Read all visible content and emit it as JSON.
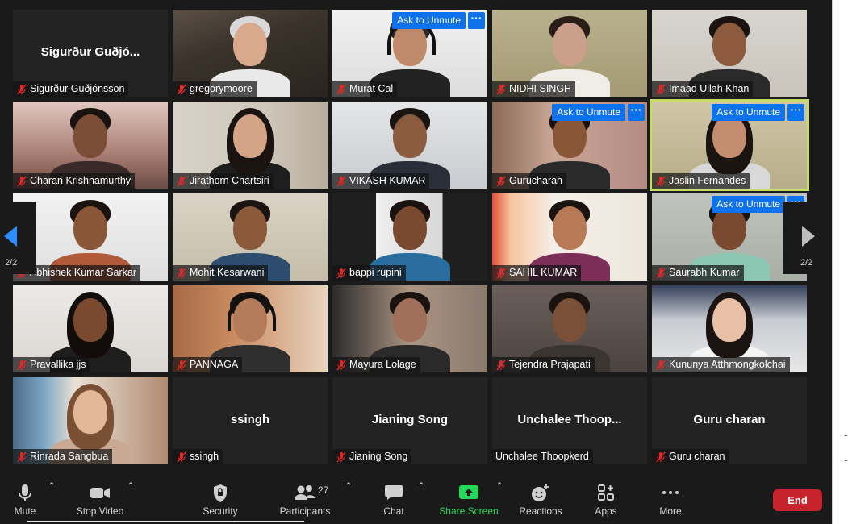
{
  "participants": [
    {
      "name": "Sigurður Guðjónsson",
      "big_name": "Sigurður  Guðjó...",
      "muted": true
    },
    {
      "name": "gregorymoore",
      "muted": true
    },
    {
      "name": "Murat Cal",
      "muted": true,
      "ask_unmute": "Ask to Unmute"
    },
    {
      "name": "NIDHI SINGH",
      "muted": true
    },
    {
      "name": "Imaad Ullah Khan",
      "muted": true
    },
    {
      "name": "Charan Krishnamurthy",
      "muted": true
    },
    {
      "name": "Jirathorn Chartsiri",
      "muted": true
    },
    {
      "name": "VIKASH KUMAR",
      "muted": true
    },
    {
      "name": "Gurucharan",
      "muted": true,
      "ask_unmute": "Ask to Unmute"
    },
    {
      "name": "Jaslin Fernandes",
      "muted": true,
      "ask_unmute": "Ask to Unmute"
    },
    {
      "name": "Abhishek Kumar Sarkar",
      "muted": true
    },
    {
      "name": "Mohit Kesarwani",
      "muted": true
    },
    {
      "name": "bappi rupini",
      "muted": true
    },
    {
      "name": "SAHIL KUMAR",
      "muted": true
    },
    {
      "name": "Saurabh Kumar",
      "muted": true,
      "ask_unmute": "Ask to Unmute"
    },
    {
      "name": "Pravallika jjs",
      "muted": true
    },
    {
      "name": "PANNAGA",
      "muted": true
    },
    {
      "name": "Mayura Lolage",
      "muted": true
    },
    {
      "name": "Tejendra Prajapati",
      "muted": true
    },
    {
      "name": "Kununya Atthmongkolchai",
      "muted": true
    },
    {
      "name": "Rinrada Sangbua",
      "muted": true
    },
    {
      "name": "ssingh",
      "big_name": "ssingh",
      "muted": true
    },
    {
      "name": "Jianing Song",
      "big_name": "Jianing Song",
      "muted": true
    },
    {
      "name": "Unchalee Thoopkerd",
      "big_name": "Unchalee  Thoop...",
      "muted": false
    },
    {
      "name": "Guru charan",
      "big_name": "Guru charan",
      "muted": true
    }
  ],
  "pagination": {
    "left_page": "2/2",
    "right_page": "2/2"
  },
  "toolbar": {
    "mute": "Mute",
    "stop_video": "Stop Video",
    "security": "Security",
    "participants": "Participants",
    "participants_count": "27",
    "chat": "Chat",
    "share_screen": "Share Screen",
    "reactions": "Reactions",
    "apps": "Apps",
    "more": "More",
    "end": "End"
  },
  "colors": {
    "ask_button": "#0e72ed",
    "active_speaker": "#c7dc68",
    "share_screen": "#23d959",
    "end_button": "#c8232c",
    "muted_icon": "#e02828"
  }
}
